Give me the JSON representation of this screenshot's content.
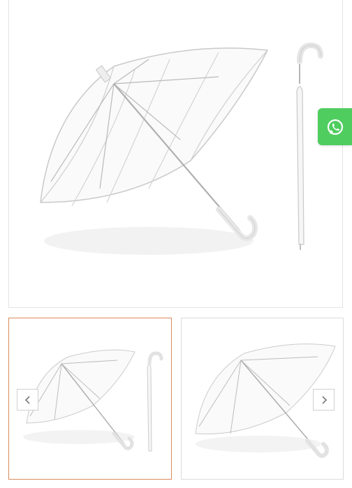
{
  "gallery": {
    "main_image_alt": "",
    "thumbnails": [
      {
        "selected": true
      },
      {
        "selected": false
      }
    ],
    "prev_icon": "chevron-left-icon",
    "next_icon": "chevron-right-icon",
    "selected_border_color": "#d98b5c"
  },
  "whatsapp": {
    "icon": "whatsapp-icon",
    "color": "#4fcd5f"
  }
}
